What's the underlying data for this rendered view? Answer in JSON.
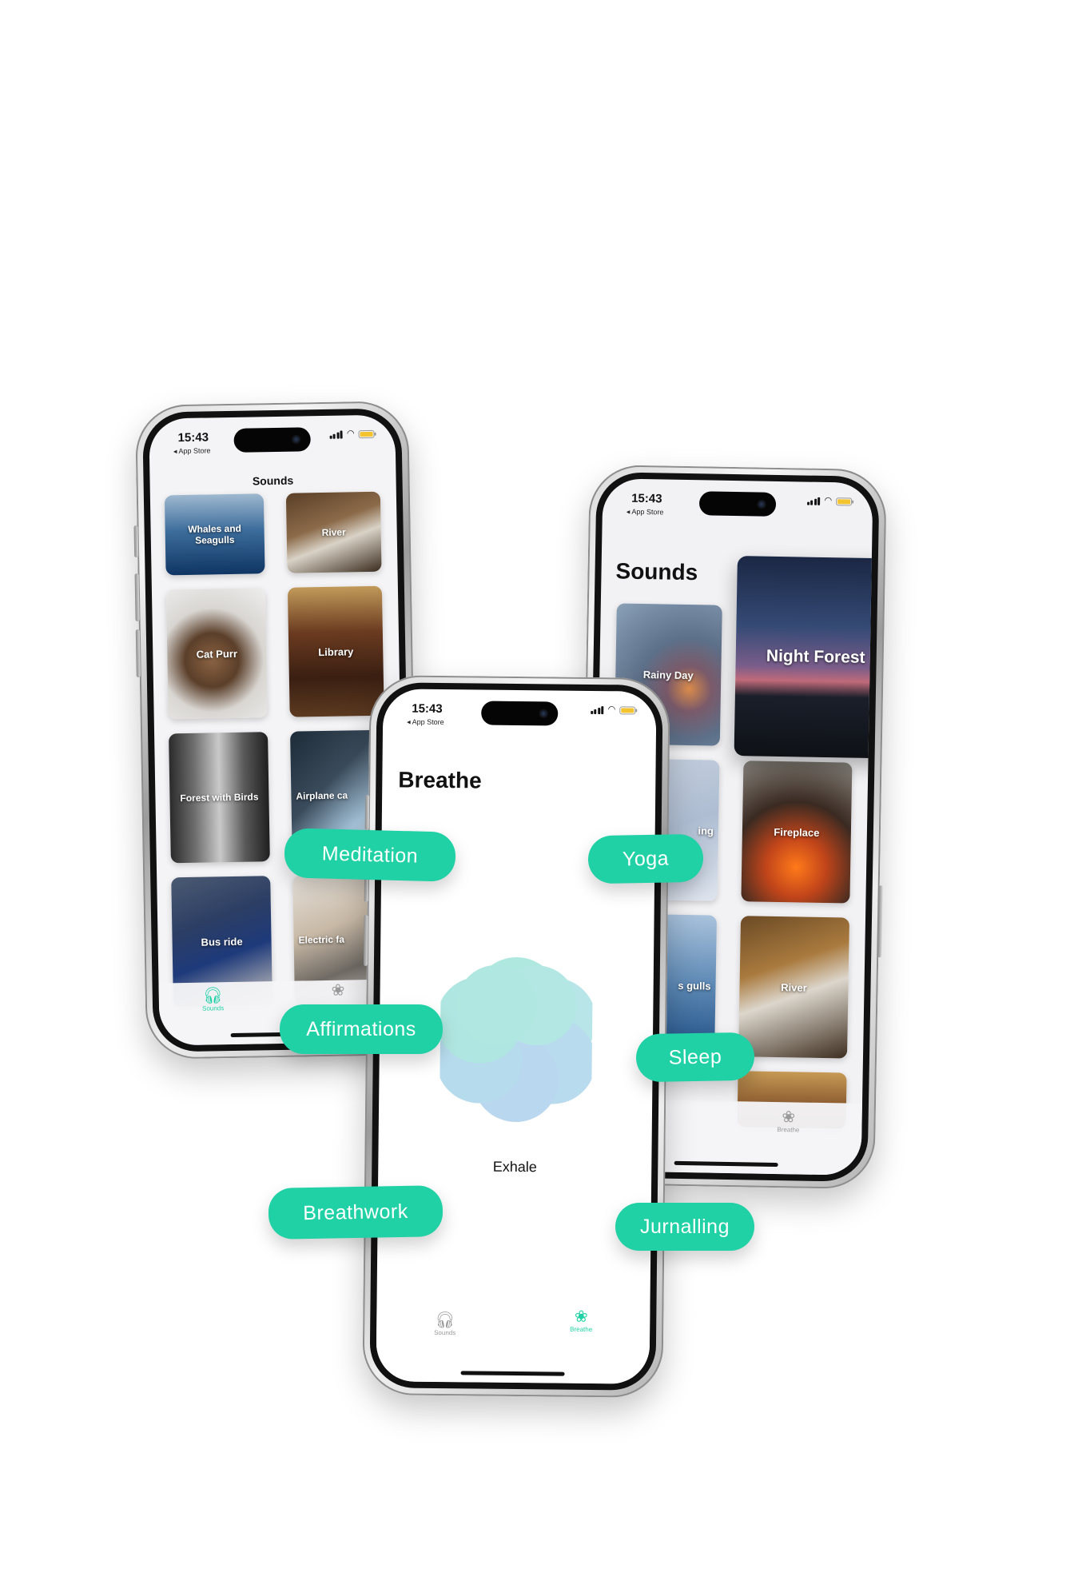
{
  "colors": {
    "accent": "#1fd1a5",
    "tab_active": "#1fd1a5",
    "tab_inactive": "#9a9a9a"
  },
  "phone_left": {
    "status": {
      "time": "15:43",
      "back_label": "◂ App Store"
    },
    "nav_title": "Sounds",
    "tiles": [
      {
        "label": "Whales and Seagulls"
      },
      {
        "label": "River"
      },
      {
        "label": "Cat Purr"
      },
      {
        "label": "Library"
      },
      {
        "label": "Forest with Birds"
      },
      {
        "label": "Airplane ca"
      },
      {
        "label": "Bus ride"
      },
      {
        "label": "Electric fa"
      }
    ],
    "tabs": [
      {
        "label": "Sounds",
        "icon": "headphones-icon",
        "active": true
      },
      {
        "label": "",
        "icon": "lotus-icon",
        "active": false
      }
    ]
  },
  "phone_right": {
    "status": {
      "time": "15:43",
      "back_label": "◂ App Store"
    },
    "title": "Sounds",
    "tiles": [
      {
        "label": "Rainy Day"
      },
      {
        "label": "Night Forest"
      },
      {
        "label": "ing"
      },
      {
        "label": "Fireplace"
      },
      {
        "label": "s gulls"
      },
      {
        "label": "River"
      },
      {
        "label": ""
      }
    ],
    "tabs": [
      {
        "label": "Breathe",
        "icon": "lotus-icon",
        "active": false
      }
    ]
  },
  "phone_center": {
    "status": {
      "time": "15:43",
      "back_label": "◂ App Store"
    },
    "title": "Breathe",
    "breath_state": "Exhale",
    "tabs": [
      {
        "label": "Sounds",
        "icon": "headphones-icon",
        "active": false
      },
      {
        "label": "Breathe",
        "icon": "lotus-icon",
        "active": true
      }
    ]
  },
  "pills": [
    "Meditation",
    "Yoga",
    "Affirmations",
    "Sleep",
    "Breathwork",
    "Jurnalling"
  ]
}
